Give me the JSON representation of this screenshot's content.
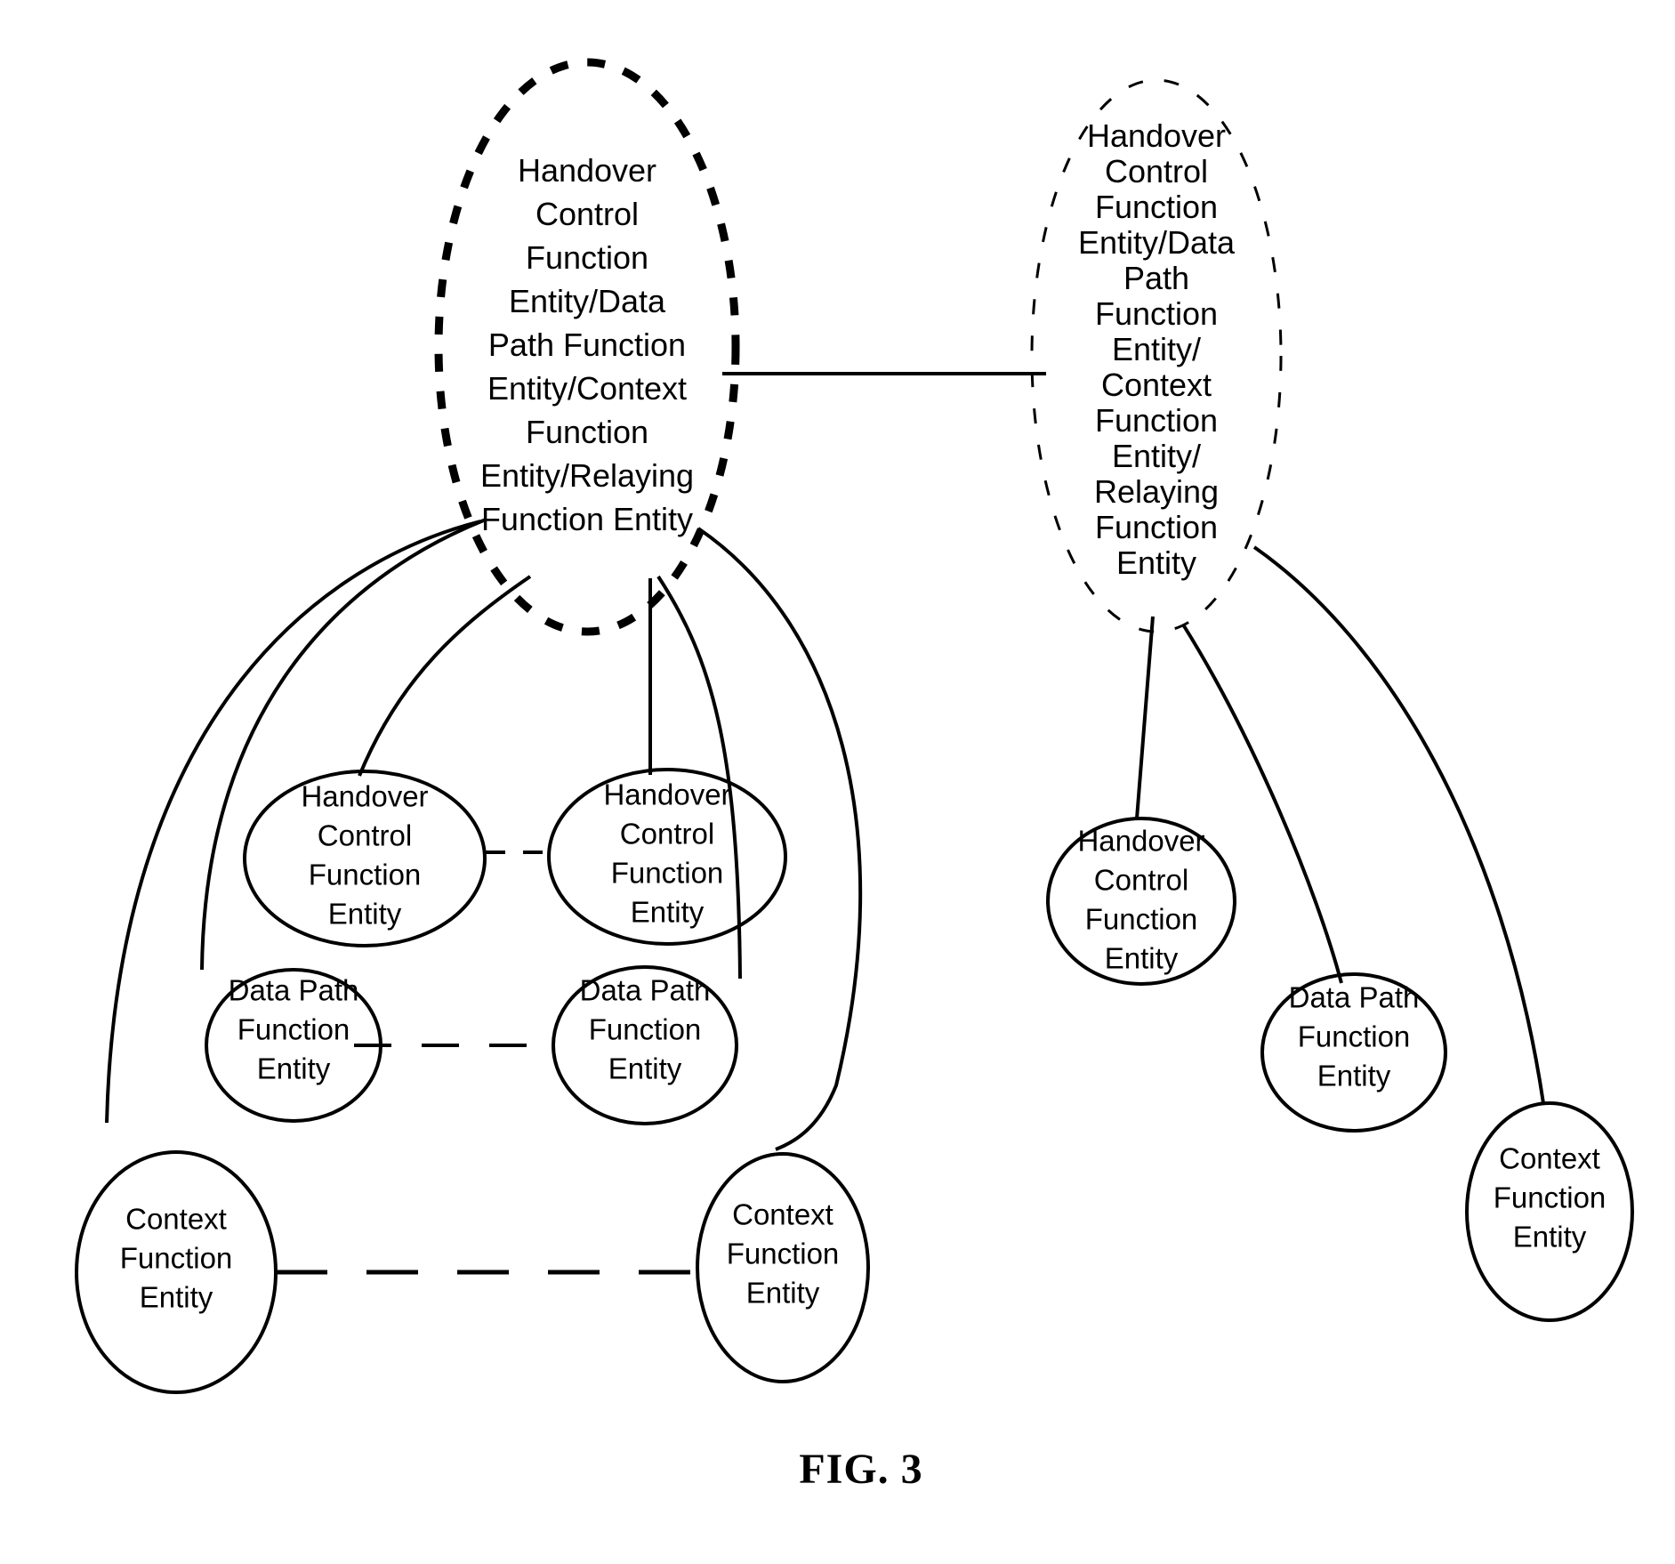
{
  "figure": {
    "caption": "FIG. 3",
    "background_color": "#ffffff",
    "stroke_color": "#000000"
  },
  "groups": [
    {
      "id": "left-group-ellipse",
      "border_style": "thick-dashed",
      "lines": [
        "Handover",
        "Control",
        "Function",
        "Entity/Data",
        "Path Function",
        "Entity/Context",
        "Function",
        "Entity/Relaying",
        "Function Entity"
      ],
      "full_text": "Handover Control Function Entity/Data Path Function Entity/Context Function Entity/Relaying Function Entity"
    },
    {
      "id": "right-group-ellipse",
      "border_style": "thin-dashed",
      "lines": [
        "Handover",
        "Control",
        "Function",
        "Entity/Data",
        "Path",
        "Function",
        "Entity/",
        "Context",
        "Function",
        "Entity/",
        "Relaying",
        "Function",
        "Entity"
      ],
      "full_text": "Handover Control Function Entity/Data Path Function Entity/Context Function Entity/Relaying Function Entity"
    }
  ],
  "nodes": [
    {
      "id": "hcfe-left-1",
      "lines": [
        "Handover",
        "Control",
        "Function",
        "Entity"
      ],
      "full_text": "Handover Control Function Entity"
    },
    {
      "id": "hcfe-left-2",
      "lines": [
        "Handover",
        "Control",
        "Function",
        "Entity"
      ],
      "full_text": "Handover Control Function Entity"
    },
    {
      "id": "dpfe-left-1",
      "lines": [
        "Data Path",
        "Function",
        "Entity"
      ],
      "full_text": "Data Path Function Entity"
    },
    {
      "id": "dpfe-left-2",
      "lines": [
        "Data Path",
        "Function",
        "Entity"
      ],
      "full_text": "Data Path Function Entity"
    },
    {
      "id": "cfe-left-1",
      "lines": [
        "Context",
        "Function",
        "Entity"
      ],
      "full_text": "Context Function Entity"
    },
    {
      "id": "cfe-left-2",
      "lines": [
        "Context",
        "Function",
        "Entity"
      ],
      "full_text": "Context Function Entity"
    },
    {
      "id": "hcfe-right-1",
      "lines": [
        "Handover",
        "Control",
        "Function",
        "Entity"
      ],
      "full_text": "Handover Control Function Entity"
    },
    {
      "id": "dpfe-right-1",
      "lines": [
        "Data Path",
        "Function",
        "Entity"
      ],
      "full_text": "Data Path Function Entity"
    },
    {
      "id": "cfe-right-1",
      "lines": [
        "Context",
        "Function",
        "Entity"
      ],
      "full_text": "Context Function Entity"
    }
  ],
  "connectors": [
    {
      "id": "group-to-group",
      "style": "solid",
      "from": "left-group-ellipse",
      "to": "right-group-ellipse"
    },
    {
      "id": "hcfe-left-1-to-hcfe-left-2",
      "style": "short-dashed",
      "from": "hcfe-left-1",
      "to": "hcfe-left-2"
    },
    {
      "id": "dpfe-left-1-to-dpfe-left-2",
      "style": "medium-dashed",
      "from": "dpfe-left-1",
      "to": "dpfe-left-2"
    },
    {
      "id": "cfe-left-1-to-cfe-left-2",
      "style": "long-dashed",
      "from": "cfe-left-1",
      "to": "cfe-left-2"
    },
    {
      "id": "left-group-to-hcfe-left-1",
      "style": "solid",
      "from": "left-group-ellipse",
      "to": "hcfe-left-1"
    },
    {
      "id": "left-group-to-hcfe-left-2",
      "style": "solid",
      "from": "left-group-ellipse",
      "to": "hcfe-left-2"
    },
    {
      "id": "left-group-to-dpfe-left-1",
      "style": "solid",
      "from": "left-group-ellipse",
      "to": "dpfe-left-1"
    },
    {
      "id": "left-group-to-dpfe-left-2",
      "style": "solid",
      "from": "left-group-ellipse",
      "to": "dpfe-left-2"
    },
    {
      "id": "left-group-to-cfe-left-1",
      "style": "solid",
      "from": "left-group-ellipse",
      "to": "cfe-left-1"
    },
    {
      "id": "left-group-to-cfe-left-2",
      "style": "solid",
      "from": "left-group-ellipse",
      "to": "cfe-left-2"
    },
    {
      "id": "right-group-to-hcfe-right-1",
      "style": "solid",
      "from": "right-group-ellipse",
      "to": "hcfe-right-1"
    },
    {
      "id": "right-group-to-dpfe-right-1",
      "style": "solid",
      "from": "right-group-ellipse",
      "to": "dpfe-right-1"
    },
    {
      "id": "right-group-to-cfe-right-1",
      "style": "solid",
      "from": "right-group-ellipse",
      "to": "cfe-right-1"
    }
  ]
}
